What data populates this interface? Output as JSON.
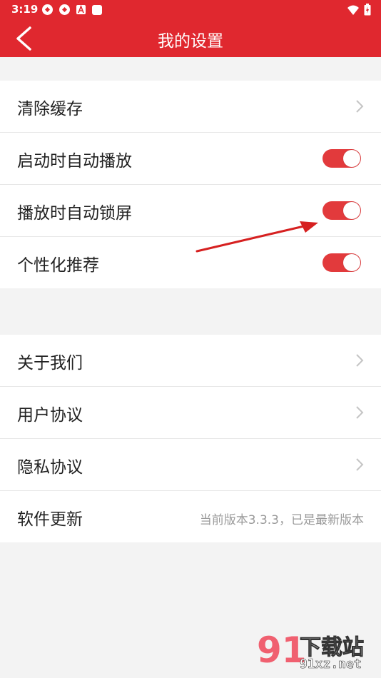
{
  "status_bar": {
    "time": "3:19"
  },
  "header": {
    "title": "我的设置"
  },
  "settings_group_1": [
    {
      "label": "清除缓存",
      "control": "chevron"
    },
    {
      "label": "启动时自动播放",
      "control": "toggle",
      "enabled": true
    },
    {
      "label": "播放时自动锁屏",
      "control": "toggle",
      "enabled": true
    },
    {
      "label": "个性化推荐",
      "control": "toggle",
      "enabled": true
    }
  ],
  "settings_group_2": [
    {
      "label": "关于我们",
      "control": "chevron"
    },
    {
      "label": "用户协议",
      "control": "chevron"
    },
    {
      "label": "隐私协议",
      "control": "chevron"
    },
    {
      "label": "软件更新",
      "control": "text",
      "value": "当前版本3.3.3，已是最新版本"
    }
  ],
  "watermark": {
    "number": "91",
    "text": "下载站",
    "url": "91xz.net"
  },
  "colors": {
    "accent": "#e0282f",
    "toggle_on": "#e23a3c",
    "page_bg": "#f3f3f3"
  }
}
